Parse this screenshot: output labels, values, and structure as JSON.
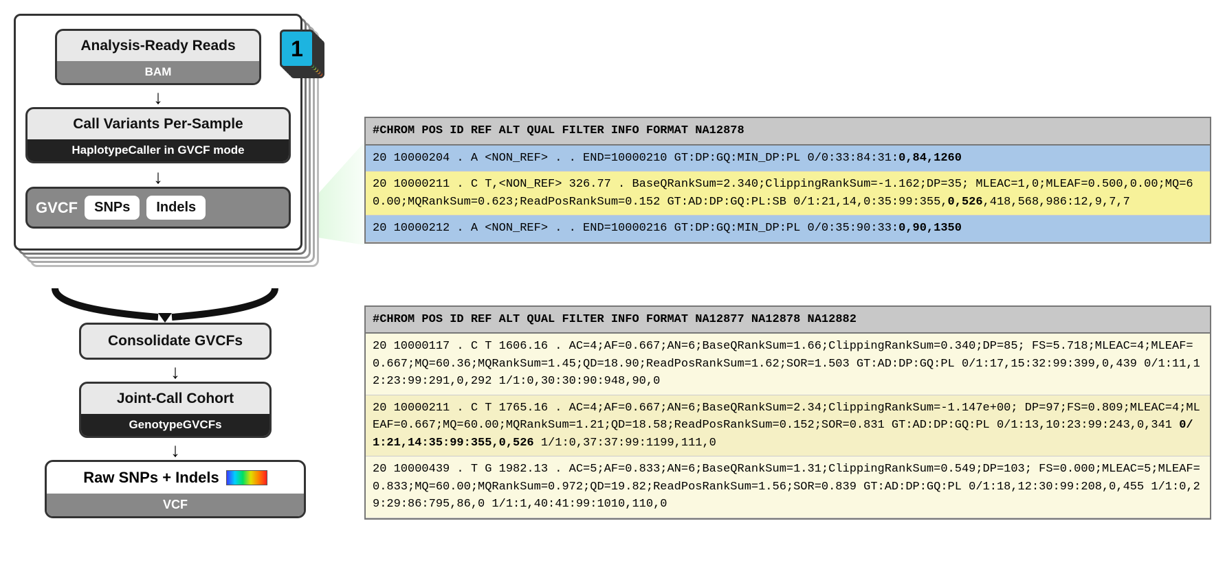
{
  "badge": {
    "number": "1"
  },
  "steps": {
    "reads": {
      "title": "Analysis-Ready Reads",
      "sub": "BAM"
    },
    "call": {
      "title": "Call Variants Per-Sample",
      "sub": "HaplotypeCaller in GVCF mode"
    },
    "gvcf": {
      "label": "GVCF",
      "pill1": "SNPs",
      "pill2": "Indels"
    },
    "consolidate": {
      "title": "Consolidate GVCFs"
    },
    "joint": {
      "title": "Joint-Call Cohort",
      "sub": "GenotypeGVCFs"
    },
    "output": {
      "title": "Raw SNPs + Indels",
      "sub": "VCF"
    }
  },
  "table1": {
    "header": "#CHROM POS ID REF ALT QUAL FILTER INFO FORMAT ",
    "header_bold": "NA12878",
    "r1a": "20 10000204 .  A  <NON_REF> .   .   END=10000210 GT:DP:GQ:MIN_DP:PL 0/0:33:84:31:",
    "r1b": "0,84,1260",
    "r2": "20 10000211 .  C  T,<NON_REF> 326.77 .  BaseQRankSum=2.340;ClippingRankSum=-1.162;DP=35; MLEAC=1,0;MLEAF=0.500,0.00;MQ=60.00;MQRankSum=0.623;ReadPosRankSum=0.152 GT:AD:DP:GQ:PL:SB  0/1:21,14,0:35:99:355,",
    "r2b": "0,526",
    "r2c": ",418,568,986:12,9,7,7",
    "r3a": "20 10000212 .  A  <NON_REF> .   .   END=10000216 GT:DP:GQ:MIN_DP:PL 0/0:35:90:33:",
    "r3b": "0,90,1350"
  },
  "table2": {
    "header": "#CHROM POS ID REF ALT QUAL FILTER INFO FORMAT NA12877 ",
    "header_bold": "NA12878",
    "header_tail": " NA12882",
    "r1": "20 10000117 .  C  T  1606.16  .  AC=4;AF=0.667;AN=6;BaseQRankSum=1.66;ClippingRankSum=0.340;DP=85; FS=5.718;MLEAC=4;MLEAF=0.667;MQ=60.36;MQRankSum=1.45;QD=18.90;ReadPosRankSum=1.62;SOR=1.503 GT:AD:DP:GQ:PL  0/1:17,15:32:99:399,0,439   0/1:11,12:23:99:291,0,292   1/1:0,30:30:90:948,90,0",
    "r2a": "20 10000211 .  C  T  1765.16  .  AC=4;AF=0.667;AN=6;BaseQRankSum=2.34;ClippingRankSum=-1.147e+00; DP=97;FS=0.809;MLEAC=4;MLEAF=0.667;MQ=60.00;MQRankSum=1.21;QD=18.58;ReadPosRankSum=0.152;SOR=0.831 GT:AD:DP:GQ:PL  0/1:13,10:23:99:243,0,341   ",
    "r2b": "0/1:21,14:35:99:355,0,526",
    "r2c": "   1/1:0,37:37:99:1199,111,0",
    "r3": "20 10000439 .  T  G  1982.13  .  AC=5;AF=0.833;AN=6;BaseQRankSum=1.31;ClippingRankSum=0.549;DP=103; FS=0.000;MLEAC=5;MLEAF=0.833;MQ=60.00;MQRankSum=0.972;QD=19.82;ReadPosRankSum=1.56;SOR=0.839 GT:AD:DP:GQ:PL  0/1:18,12:30:99:208,0,455   1/1:0,29:29:86:795,86,0   1/1:1,40:41:99:1010,110,0"
  }
}
